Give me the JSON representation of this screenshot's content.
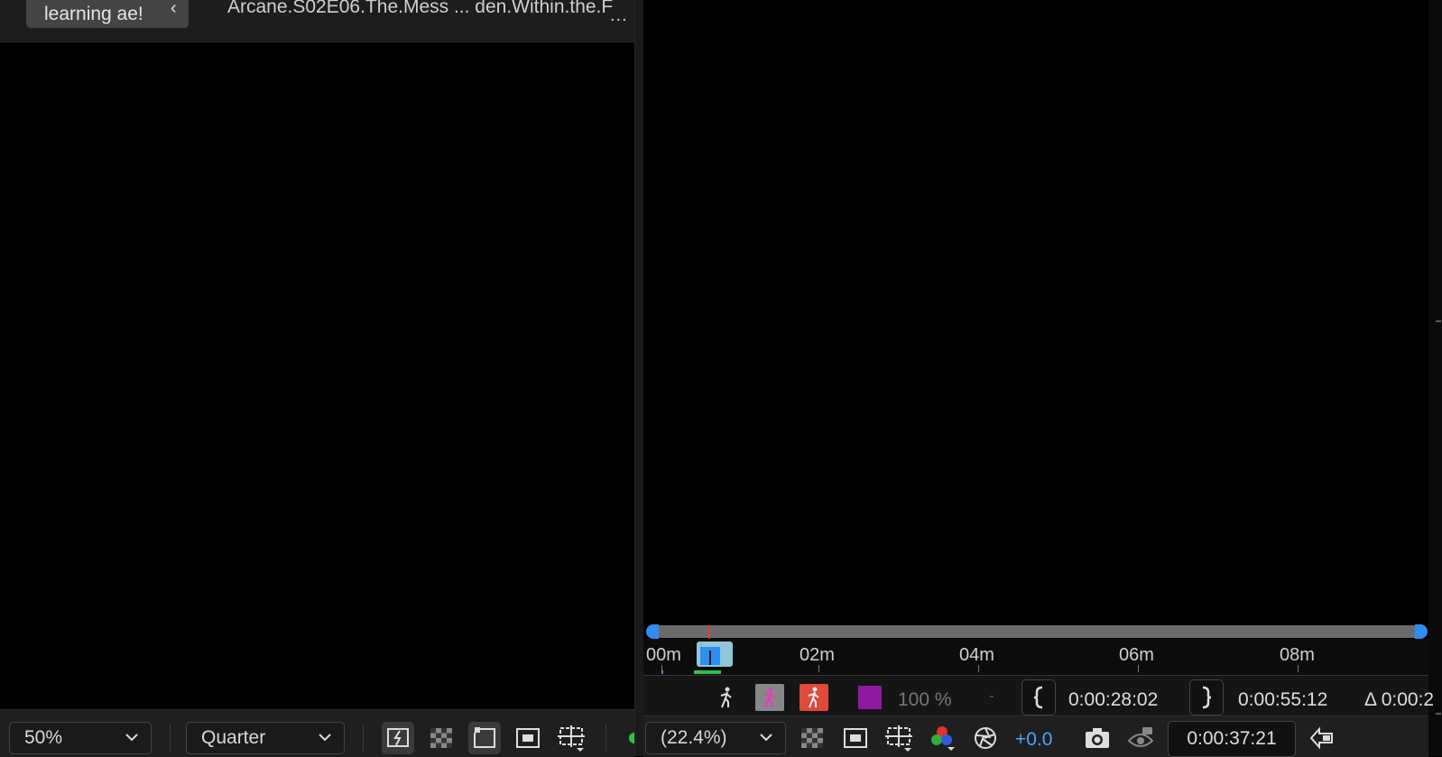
{
  "left_panel": {
    "tabs": {
      "active_label": "learning ae!",
      "comp_label": "Arcane.S02E06.The.Mess ... den.Within.the.F",
      "more_label": "..."
    },
    "toolbar": {
      "magnification": "50%",
      "resolution": "Quarter"
    }
  },
  "right_panel": {
    "ruler": {
      "labels": [
        "00m",
        "02m",
        "04m",
        "06m",
        "08m"
      ]
    },
    "controls": {
      "opacity": "100 %",
      "in_point": "0:00:28:02",
      "out_point": "0:00:55:12",
      "duration": "Δ 0:00:2",
      "zoom": "(22.4%)",
      "exposure": "+0.0",
      "current_time": "0:00:37:21"
    },
    "colors": {
      "accent": "#2f8cf0",
      "playhead": "#e03a3a",
      "work_area": "#8ec7d8",
      "layer_color": "#8e1aa0",
      "exposure_text": "#4aa3ff"
    }
  }
}
